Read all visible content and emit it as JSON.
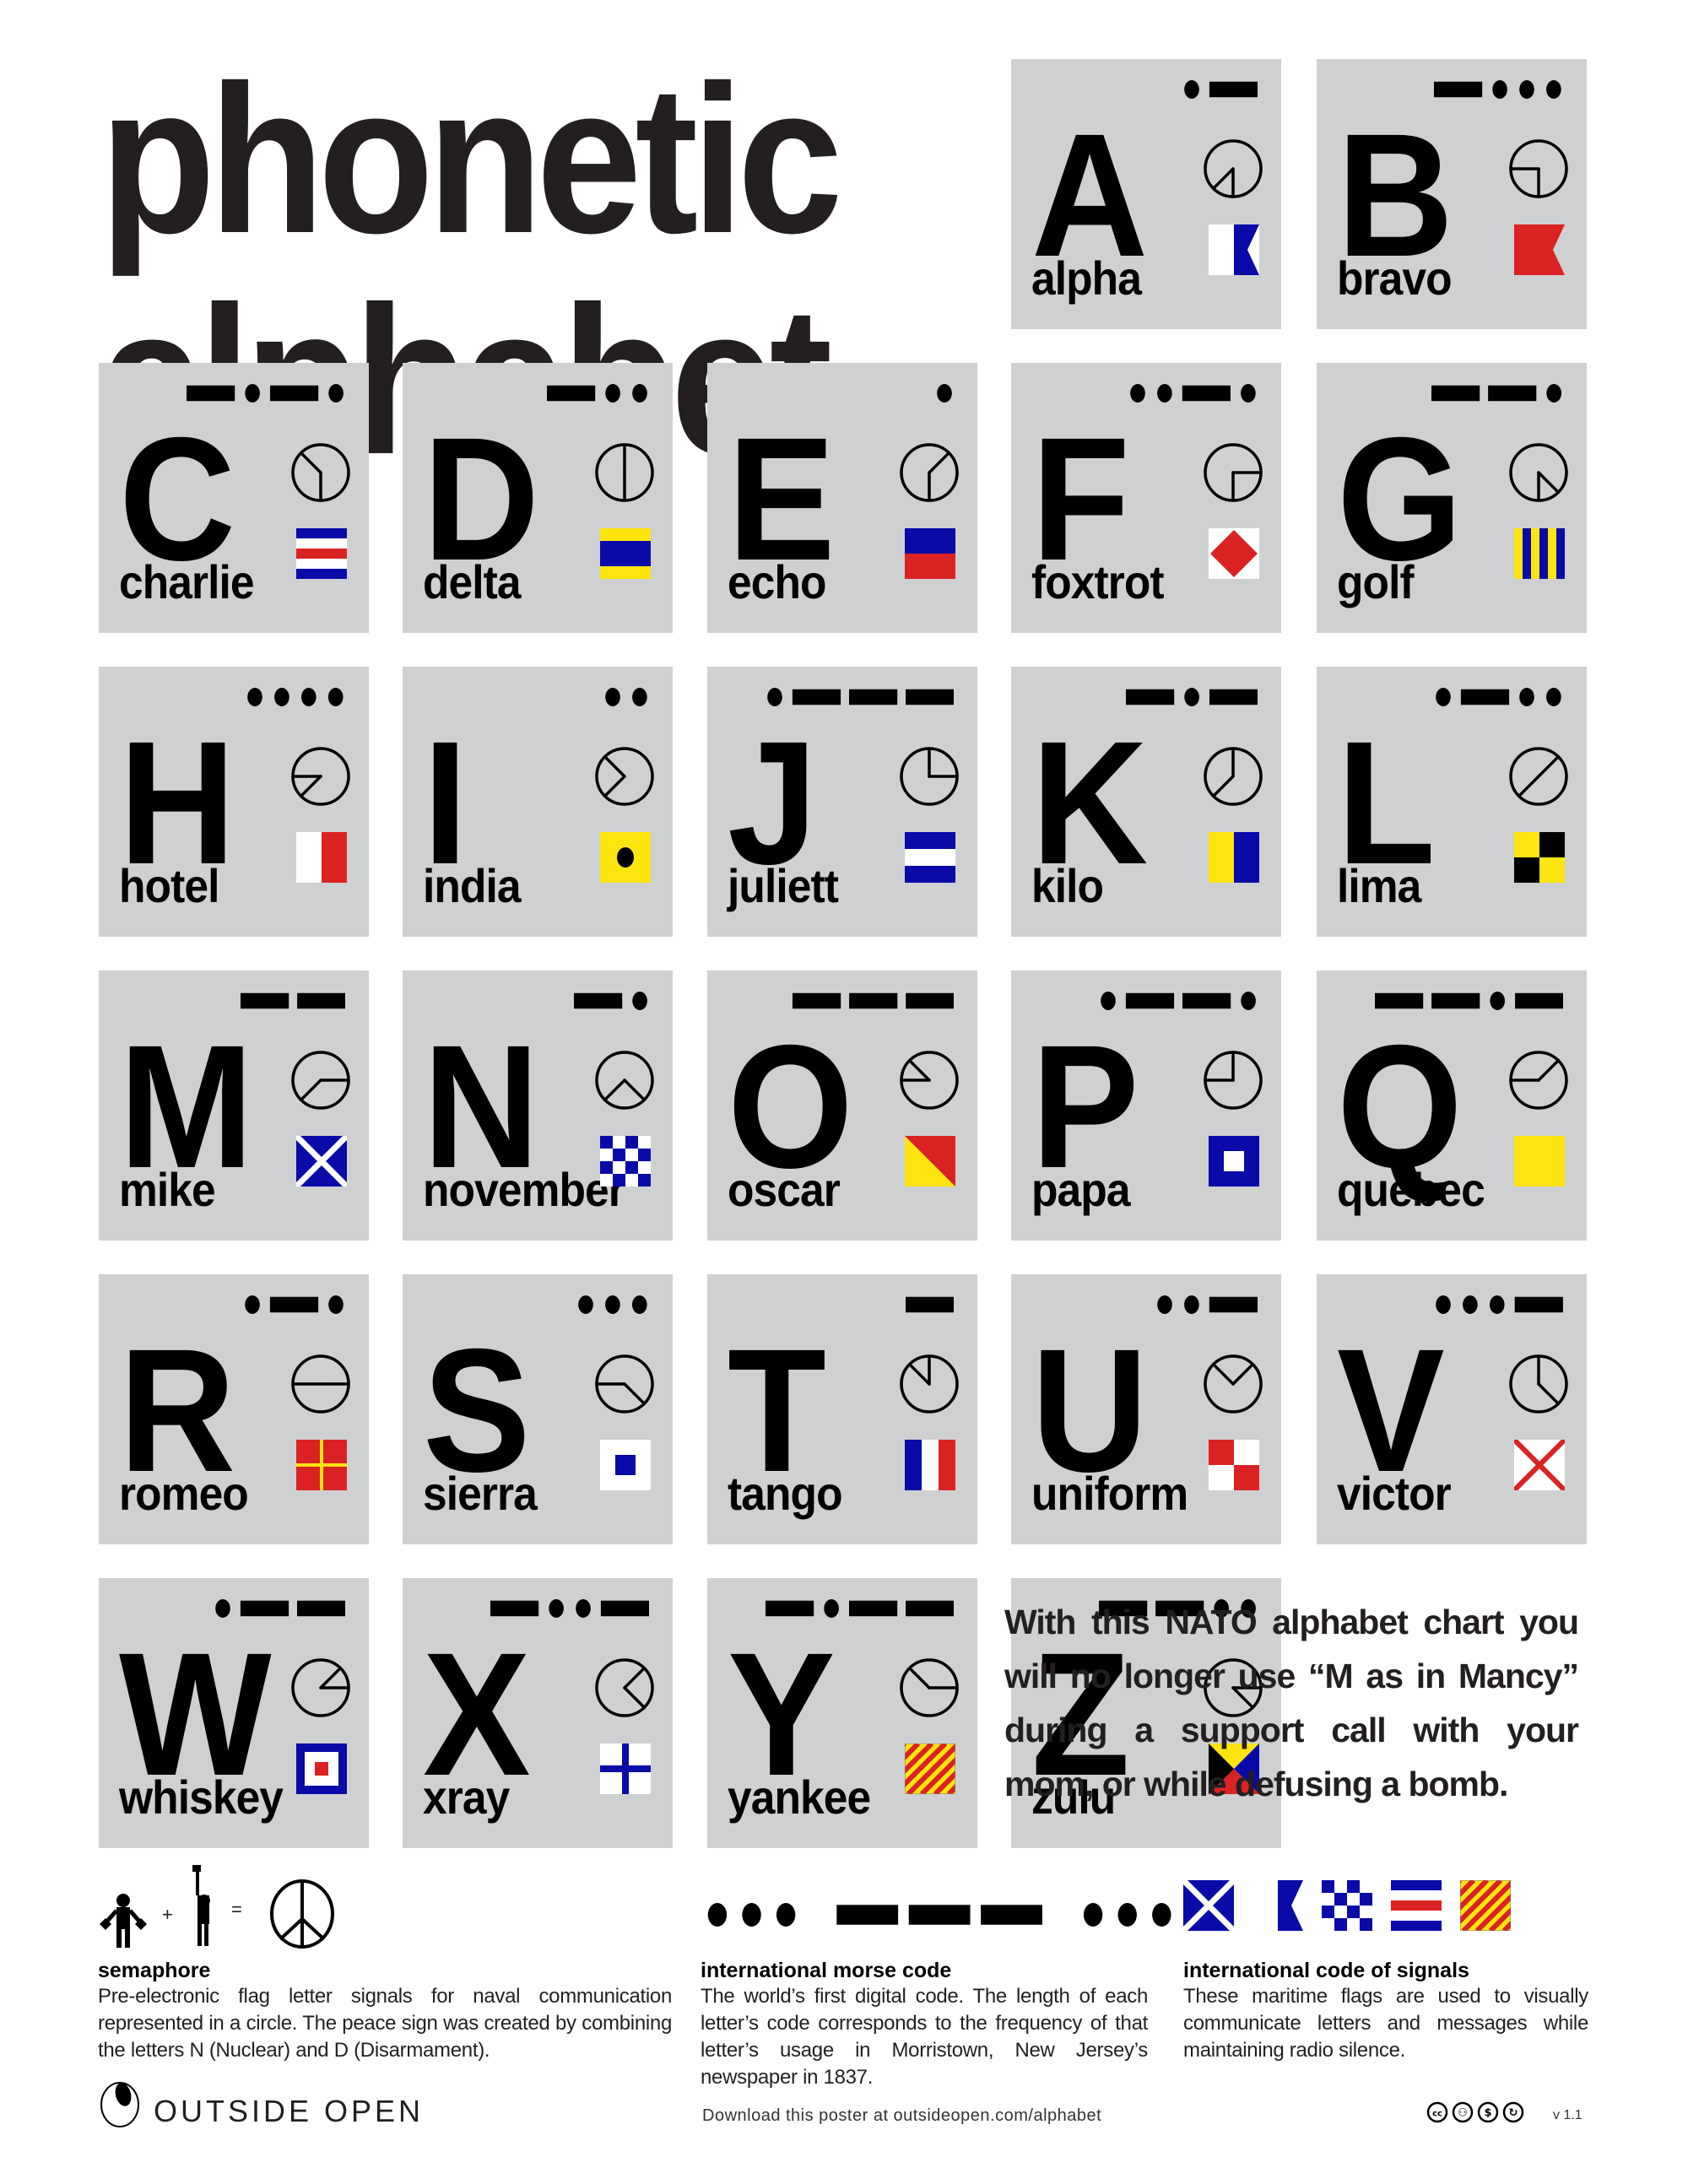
{
  "title": {
    "line1": "phonetic",
    "line2": "alphabet"
  },
  "colors": {
    "tile": "#cfd0d1",
    "blue": "#0a0aa8",
    "red": "#db2222",
    "yellow": "#ffe510",
    "white": "#ffffff",
    "black": "#000000"
  },
  "letters": [
    {
      "letter": "A",
      "word": "alpha",
      "morse": ".-",
      "semaphore": [
        6,
        7.5
      ],
      "flag": "alpha-flag-icon"
    },
    {
      "letter": "B",
      "word": "bravo",
      "morse": "-...",
      "semaphore": [
        6,
        9
      ],
      "flag": "bravo-flag-icon"
    },
    {
      "letter": "C",
      "word": "charlie",
      "morse": "-.-.",
      "semaphore": [
        6,
        10.5
      ],
      "flag": "charlie-flag-icon"
    },
    {
      "letter": "D",
      "word": "delta",
      "morse": "-..",
      "semaphore": [
        6,
        12
      ],
      "flag": "delta-flag-icon"
    },
    {
      "letter": "E",
      "word": "echo",
      "morse": ".",
      "semaphore": [
        6,
        1.5
      ],
      "flag": "echo-flag-icon"
    },
    {
      "letter": "F",
      "word": "foxtrot",
      "morse": "..-.",
      "semaphore": [
        6,
        3
      ],
      "flag": "foxtrot-flag-icon"
    },
    {
      "letter": "G",
      "word": "golf",
      "morse": "--.",
      "semaphore": [
        6,
        4.5
      ],
      "flag": "golf-flag-icon"
    },
    {
      "letter": "H",
      "word": "hotel",
      "morse": "....",
      "semaphore": [
        9,
        7.5
      ],
      "flag": "hotel-flag-icon"
    },
    {
      "letter": "I",
      "word": "india",
      "morse": "..",
      "semaphore": [
        10.5,
        7.5
      ],
      "flag": "india-flag-icon"
    },
    {
      "letter": "J",
      "word": "juliett",
      "morse": ".---",
      "semaphore": [
        12,
        3
      ],
      "flag": "juliett-flag-icon"
    },
    {
      "letter": "K",
      "word": "kilo",
      "morse": "-.-",
      "semaphore": [
        12,
        7.5
      ],
      "flag": "kilo-flag-icon"
    },
    {
      "letter": "L",
      "word": "lima",
      "morse": ".-..",
      "semaphore": [
        1.5,
        7.5
      ],
      "flag": "lima-flag-icon"
    },
    {
      "letter": "M",
      "word": "mike",
      "morse": "--",
      "semaphore": [
        3,
        7.5
      ],
      "flag": "mike-flag-icon"
    },
    {
      "letter": "N",
      "word": "november",
      "morse": "-.",
      "semaphore": [
        4.5,
        7.5
      ],
      "flag": "november-flag-icon"
    },
    {
      "letter": "O",
      "word": "oscar",
      "morse": "---",
      "semaphore": [
        9,
        10.5
      ],
      "flag": "oscar-flag-icon"
    },
    {
      "letter": "P",
      "word": "papa",
      "morse": ".--.",
      "semaphore": [
        9,
        12
      ],
      "flag": "papa-flag-icon"
    },
    {
      "letter": "Q",
      "word": "quebec",
      "morse": "--.-",
      "semaphore": [
        9,
        1.5
      ],
      "flag": "quebec-flag-icon"
    },
    {
      "letter": "R",
      "word": "romeo",
      "morse": ".-.",
      "semaphore": [
        9,
        3
      ],
      "flag": "romeo-flag-icon"
    },
    {
      "letter": "S",
      "word": "sierra",
      "morse": "...",
      "semaphore": [
        9,
        4.5
      ],
      "flag": "sierra-flag-icon"
    },
    {
      "letter": "T",
      "word": "tango",
      "morse": "-",
      "semaphore": [
        10.5,
        12
      ],
      "flag": "tango-flag-icon"
    },
    {
      "letter": "U",
      "word": "uniform",
      "morse": "..-",
      "semaphore": [
        10.5,
        1.5
      ],
      "flag": "uniform-flag-icon"
    },
    {
      "letter": "V",
      "word": "victor",
      "morse": "...-",
      "semaphore": [
        12,
        4.5
      ],
      "flag": "victor-flag-icon"
    },
    {
      "letter": "W",
      "word": "whiskey",
      "morse": ".--",
      "semaphore": [
        1.5,
        3
      ],
      "flag": "whiskey-flag-icon"
    },
    {
      "letter": "X",
      "word": "xray",
      "morse": "-..-",
      "semaphore": [
        1.5,
        4.5
      ],
      "flag": "xray-flag-icon"
    },
    {
      "letter": "Y",
      "word": "yankee",
      "morse": "-.--",
      "semaphore": [
        10.5,
        3
      ],
      "flag": "yankee-flag-icon"
    },
    {
      "letter": "Z",
      "word": "zulu",
      "morse": "--..",
      "semaphore": [
        3,
        4.5
      ],
      "flag": "zulu-flag-icon"
    }
  ],
  "blurb": "With this NATO alphabet chart you will no longer use “M as in Mancy” during a support call with your mom, or while defusing a bomb.",
  "legend": {
    "semaphore": {
      "plus": "+",
      "equals": "=",
      "heading": "semaphore",
      "body": "Pre-electronic flag letter signals for naval communication represented in a circle. The peace sign was created by combining the letters N (Nuclear) and D (Disarmament)."
    },
    "morse": {
      "example": "... --- ...",
      "heading": "international morse code",
      "body": "The world’s first digital code. The length of each letter’s code corresponds to the frequency of that letter’s usage in Morristown, New Jersey’s newspaper in 1837."
    },
    "flags": {
      "examples": [
        "mike-flag-icon",
        "alpha-flag-icon",
        "november-flag-icon",
        "charlie-flag-icon",
        "yankee-flag-icon"
      ],
      "heading": "international code of signals",
      "body": "These maritime flags are used to visually communicate letters and messages while maintaining radio silence."
    }
  },
  "footer": {
    "brand": "OUTSIDE OPEN",
    "download": "Download this poster at outsideopen.com/alphabet",
    "license_icons": [
      "cc-icon",
      "by-icon",
      "nc-icon",
      "sa-icon"
    ],
    "version": "v 1.1"
  }
}
